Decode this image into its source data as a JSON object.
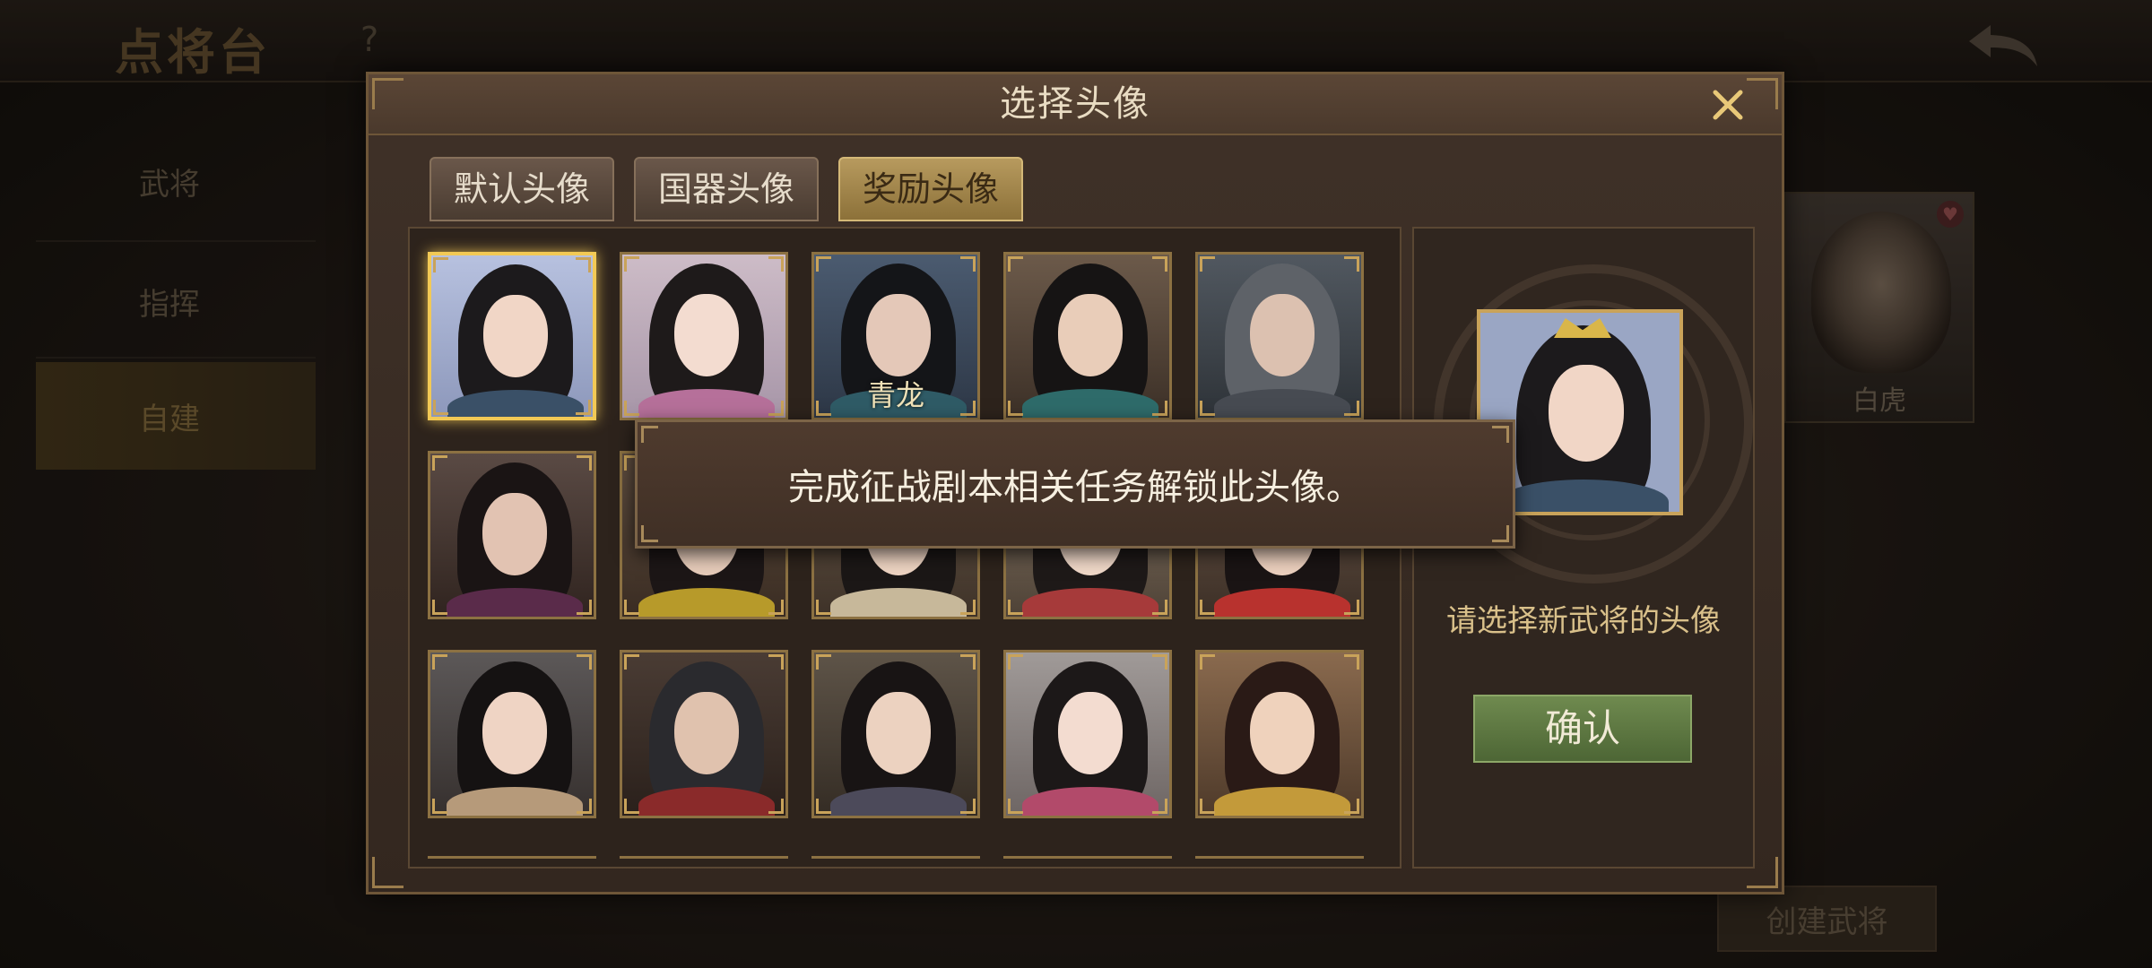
{
  "background": {
    "title": "点将台",
    "help": "?",
    "nav": [
      {
        "label": "武将"
      },
      {
        "label": "指挥"
      },
      {
        "label": "自建"
      }
    ],
    "card_label": "白虎",
    "create_button": "创建武将"
  },
  "dialog": {
    "title": "选择头像",
    "tabs": [
      {
        "label": "默认头像"
      },
      {
        "label": "国器头像"
      },
      {
        "label": "奖励头像"
      }
    ],
    "active_tab": "奖励头像",
    "portrait_label_qinglong": "青龙",
    "preview_hint": "请选择新武将的头像",
    "confirm_label": "确认"
  },
  "tooltip": {
    "text": "完成征战剧本相关任务解锁此头像。"
  },
  "colors": {
    "accent_gold": "#f2c955",
    "confirm_green": "#6f8a4f",
    "panel_brown": "#3f3128"
  }
}
